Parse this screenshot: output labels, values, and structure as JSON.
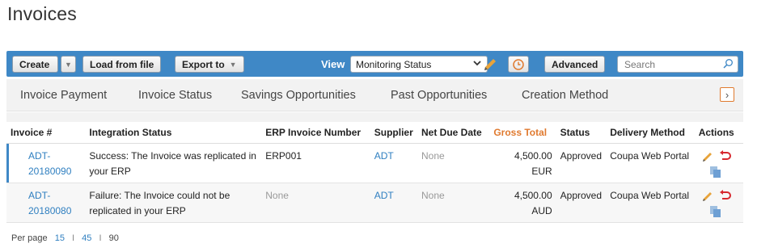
{
  "page": {
    "title": "Invoices"
  },
  "toolbar": {
    "create_label": "Create",
    "load_label": "Load from file",
    "export_label": "Export to",
    "view_label": "View",
    "view_value": "Monitoring Status",
    "advanced_label": "Advanced",
    "search_placeholder": "Search"
  },
  "tabs": [
    "Invoice Payment",
    "Invoice Status",
    "Savings Opportunities",
    "Past Opportunities",
    "Creation Method"
  ],
  "table": {
    "headers": [
      "Invoice #",
      "Integration Status",
      "ERP Invoice Number",
      "Supplier",
      "Net Due Date",
      "Gross Total",
      "Status",
      "Delivery Method",
      "Actions"
    ],
    "rows": [
      {
        "invoice_a": "ADT-",
        "invoice_b": "20180090",
        "integration_status": "Success: The Invoice was replicated in your ERP",
        "erp_number": "ERP001",
        "supplier": "ADT",
        "net_due_date": "None",
        "gross_amount": "4,500.00",
        "gross_currency": "EUR",
        "status": "Approved",
        "delivery_method": "Coupa Web Portal"
      },
      {
        "invoice_a": "ADT-",
        "invoice_b": "20180080",
        "integration_status": "Failure: The Invoice could not be replicated in your ERP",
        "erp_number": "None",
        "supplier": "ADT",
        "net_due_date": "None",
        "gross_amount": "4,500.00",
        "gross_currency": "AUD",
        "status": "Approved",
        "delivery_method": "Coupa Web Portal"
      }
    ]
  },
  "pager": {
    "label": "Per page",
    "options": [
      "15",
      "45",
      "90"
    ]
  },
  "colors": {
    "toolbar": "#3f88c6",
    "accent": "#e07a2f",
    "link": "#2f7fc0"
  }
}
